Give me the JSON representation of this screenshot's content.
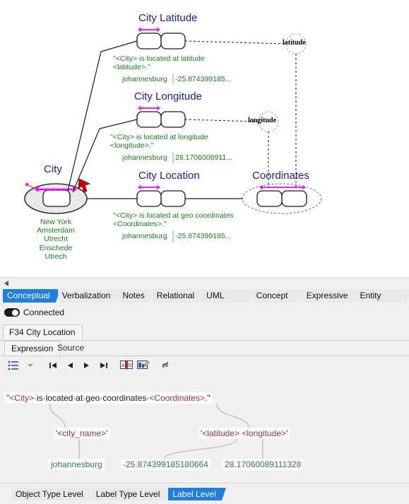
{
  "diagram": {
    "object_types": [
      {
        "name": "City",
        "label": "City",
        "population": "New York\nAmsterdam\nUtrecht\nEnschede\nUtrech"
      },
      {
        "name": "Coordinates",
        "label": "Coordinates"
      }
    ],
    "fact_types": [
      {
        "name": "city-latitude",
        "title": "City Latitude",
        "verbalization": "\"<City> is located at latitude <latitude>.\"",
        "sample_left": "johannesburg",
        "sample_right": "-25.874399185..."
      },
      {
        "name": "city-longitude",
        "title": "City Longitude",
        "verbalization": "\"<City> is located at longitude <longitude>.\"",
        "sample_left": "johannesburg",
        "sample_right": "28.1706008911..."
      },
      {
        "name": "city-location",
        "title": "City Location",
        "verbalization": "\"<City> is located at geo coordinates <Coordinates>.\"",
        "sample_left": "johannesburg",
        "sample_right": "-25.874399185..."
      }
    ],
    "roles": [
      {
        "name": "latitude",
        "label": "latitude"
      },
      {
        "name": "longitude",
        "label": "longitude"
      }
    ],
    "colors": {
      "title": "#1a1a9c",
      "verbalization": "#1a7a1a",
      "uniqueness_bar": "#ff00ff",
      "cursor": "#cc0000"
    }
  },
  "tabs": {
    "items": [
      {
        "label": "Conceptual",
        "active": true
      },
      {
        "label": "Verbalization",
        "active": false
      },
      {
        "label": "Notes",
        "active": false
      },
      {
        "label": "Relational",
        "active": false
      },
      {
        "label": "UML Classes",
        "active": false
      },
      {
        "label": "Concept Map",
        "active": false
      },
      {
        "label": "Expressive",
        "active": false
      },
      {
        "label": "Entity Relation",
        "active": false
      }
    ]
  },
  "connection": {
    "label": "Connected",
    "state": "on"
  },
  "document_tab": {
    "label": "F34 City Location"
  },
  "inner_tabs": {
    "items": [
      {
        "label": "Expression",
        "active": true
      },
      {
        "label": "Source",
        "active": false
      }
    ]
  },
  "toolbar": {
    "buttons": [
      {
        "name": "list-icon",
        "title": "List"
      },
      {
        "name": "chevron-down-icon",
        "title": "Dropdown"
      },
      {
        "name": "first-icon",
        "title": "First"
      },
      {
        "name": "previous-icon",
        "title": "Previous"
      },
      {
        "name": "next-icon",
        "title": "Next"
      },
      {
        "name": "last-icon",
        "title": "Last"
      },
      {
        "name": "translate-icon",
        "title": "a|b Translate"
      },
      {
        "name": "edit-image-icon",
        "title": "Edit"
      },
      {
        "name": "link-icon",
        "title": "Link"
      }
    ]
  },
  "expression_tree": {
    "root": {
      "parts": [
        {
          "text": "\"",
          "color": "black"
        },
        {
          "text": "<City>",
          "color": "red"
        },
        {
          "text": "·is·located·at·geo·coordinates·",
          "color": "black"
        },
        {
          "text": "<Coordinates>",
          "color": "red"
        },
        {
          "text": ".\"",
          "color": "black"
        }
      ]
    },
    "level2": [
      {
        "name": "city-name-node",
        "parts": [
          {
            "text": "'",
            "color": "black"
          },
          {
            "text": "<city_name>",
            "color": "red"
          },
          {
            "text": "'",
            "color": "black"
          }
        ]
      },
      {
        "name": "lat-long-node",
        "parts": [
          {
            "text": "'",
            "color": "black"
          },
          {
            "text": "<latitude> <longitude>",
            "color": "red"
          },
          {
            "text": "'",
            "color": "black"
          }
        ]
      }
    ],
    "level3": [
      {
        "name": "city-value",
        "text": "johannesburg"
      },
      {
        "name": "latitude-value",
        "text": "-25.874399185180664"
      },
      {
        "name": "longitude-value",
        "text": "28.17060089111328"
      }
    ]
  },
  "bottom_tabs": {
    "items": [
      {
        "label": "Object Type Level",
        "active": false
      },
      {
        "label": "Label Type Level",
        "active": false
      },
      {
        "label": "Label Level",
        "active": true
      }
    ]
  }
}
